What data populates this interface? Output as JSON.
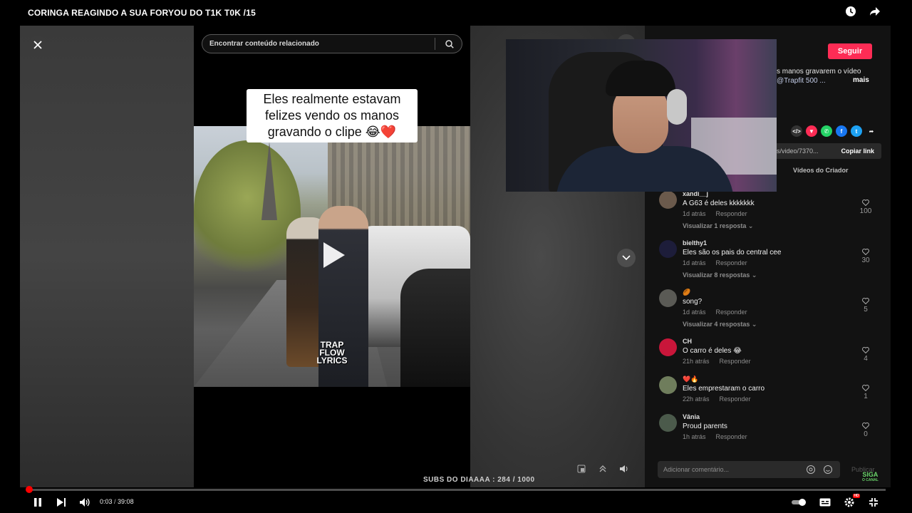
{
  "window": {
    "title": "CORINGA REAGINDO A SUA FORYOU DO T1K T0K /15"
  },
  "video_panel": {
    "search_placeholder": "Encontrar conteúdo relacionado",
    "caption_line1": "Eles realmente estavam",
    "caption_line2": "felizes vendo os manos",
    "caption_line3": "gravando o clipe 😂❤️",
    "watermark_line1": "TRAP",
    "watermark_line2": "FLOW",
    "watermark_line3": "LYRICS"
  },
  "right_panel": {
    "follow_label": "Seguir",
    "desc_text": "s manos gravarem o vídeo",
    "desc_link": "@Trapfit 500 ...",
    "desc_more": "mais",
    "share_icons": [
      "embed-icon",
      "tiktok-friends-icon",
      "whatsapp-icon",
      "facebook-icon",
      "twitter-icon",
      "share-arrow-icon"
    ],
    "link_url": "s/video/7370...",
    "copy_link_label": "Copiar link",
    "creator_tab": "Vídeos do Criador",
    "comment_placeholder": "Adicionar comentário...",
    "publish_label": "Publicar"
  },
  "comments": [
    {
      "user": "xandi__j",
      "text": "A G63 é deles kkkkkkk",
      "time": "1d atrás",
      "reply": "Responder",
      "replies": "Visualizar 1 resposta",
      "likes": "100",
      "avatar_color": "#6b5a4c"
    },
    {
      "user": "bielthy1",
      "text": "Eles são os pais do central cee",
      "time": "1d atrás",
      "reply": "Responder",
      "replies": "Visualizar 8 respostas",
      "likes": "30",
      "avatar_color": "#1d1d3a"
    },
    {
      "user": "🏉",
      "text": "song?",
      "time": "1d atrás",
      "reply": "Responder",
      "replies": "Visualizar 4 respostas",
      "likes": "5",
      "avatar_color": "#5a5a55"
    },
    {
      "user": "CH",
      "text": "O carro é deles 😂",
      "time": "21h atrás",
      "reply": "Responder",
      "replies": "",
      "likes": "4",
      "avatar_color": "#c9163a"
    },
    {
      "user": "❤️🔥",
      "text": "Eles emprestaram o carro",
      "time": "22h atrás",
      "reply": "Responder",
      "replies": "",
      "likes": "1",
      "avatar_color": "#6f7d5c"
    },
    {
      "user": "Vânia",
      "text": "Proud parents",
      "time": "1h atrás",
      "reply": "Responder",
      "replies": "",
      "likes": "0",
      "avatar_color": "#4b5a4b"
    }
  ],
  "overlay": {
    "subs_text": "SUBS DO DIAAAA : 284 / 1000",
    "siga_line1": "SIGA",
    "siga_line2": "O CANAL"
  },
  "player": {
    "current_time": "0:03",
    "separator": " / ",
    "duration": "39:08",
    "progress_fraction": 0.0013,
    "hd_badge": "HD",
    "accent_color": "#ff0000"
  }
}
